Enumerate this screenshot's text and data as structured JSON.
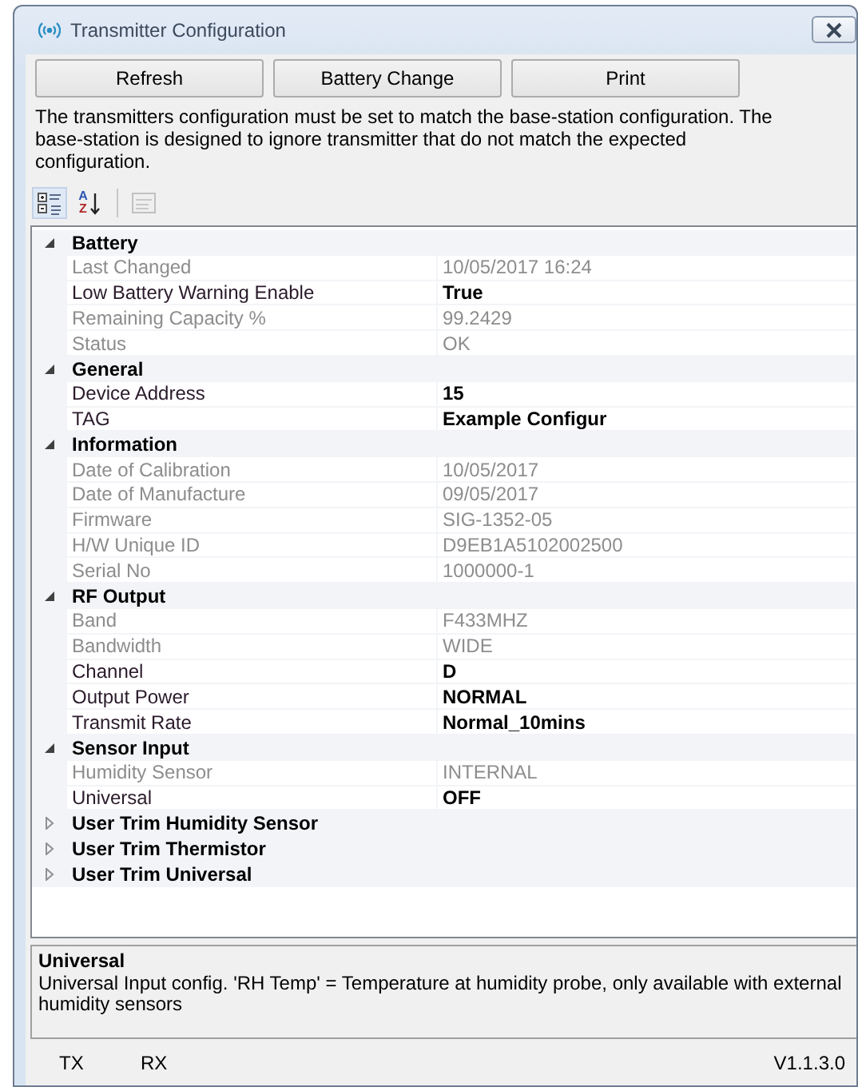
{
  "window": {
    "title": "Transmitter Configuration"
  },
  "buttons": [
    "Refresh",
    "Battery Change",
    "Print"
  ],
  "description": "The transmitters configuration must be set to match the base-station configuration. The base-station is designed to ignore transmitter that do not match the expected configuration.",
  "toolbar": [
    {
      "kind": "categorized",
      "selected": true,
      "disabled": false
    },
    {
      "kind": "alphabetical",
      "selected": false,
      "disabled": false,
      "letters": [
        "A",
        "Z"
      ]
    },
    {
      "kind": "property_pages",
      "selected": false,
      "disabled": true
    }
  ],
  "grid": {
    "categories": [
      {
        "name": "Battery",
        "expanded": true,
        "properties": [
          {
            "name": "Last Changed",
            "value": "10/05/2017 16:24",
            "readonly": true
          },
          {
            "name": "Low Battery Warning Enable",
            "value": "True",
            "readonly": false
          },
          {
            "name": "Remaining Capacity %",
            "value": "99.2429",
            "readonly": true
          },
          {
            "name": "Status",
            "value": "OK",
            "readonly": true
          }
        ]
      },
      {
        "name": "General",
        "expanded": true,
        "properties": [
          {
            "name": "Device Address",
            "value": "15",
            "readonly": false
          },
          {
            "name": "TAG",
            "value": "Example Configur",
            "readonly": false
          }
        ]
      },
      {
        "name": "Information",
        "expanded": true,
        "properties": [
          {
            "name": "Date of Calibration",
            "value": "10/05/2017",
            "readonly": true
          },
          {
            "name": "Date of Manufacture",
            "value": "09/05/2017",
            "readonly": true
          },
          {
            "name": "Firmware",
            "value": "SIG-1352-05",
            "readonly": true
          },
          {
            "name": "H/W Unique ID",
            "value": "D9EB1A5102002500",
            "readonly": true
          },
          {
            "name": "Serial No",
            "value": "1000000-1",
            "readonly": true
          }
        ]
      },
      {
        "name": "RF Output",
        "expanded": true,
        "properties": [
          {
            "name": "Band",
            "value": "F433MHZ",
            "readonly": true
          },
          {
            "name": "Bandwidth",
            "value": "WIDE",
            "readonly": true
          },
          {
            "name": "Channel",
            "value": "D",
            "readonly": false
          },
          {
            "name": "Output Power",
            "value": "NORMAL",
            "readonly": false
          },
          {
            "name": "Transmit Rate",
            "value": "Normal_10mins",
            "readonly": false
          }
        ]
      },
      {
        "name": "Sensor Input",
        "expanded": true,
        "properties": [
          {
            "name": "Humidity Sensor",
            "value": "INTERNAL",
            "readonly": true
          },
          {
            "name": "Universal",
            "value": "OFF",
            "readonly": false
          }
        ]
      },
      {
        "name": "User Trim Humidity Sensor",
        "expanded": false
      },
      {
        "name": "User Trim Thermistor",
        "expanded": false
      },
      {
        "name": "User Trim Universal",
        "expanded": false
      }
    ]
  },
  "help": {
    "title": "Universal",
    "text": "Universal Input config. 'RH Temp' = Temperature at humidity probe, only available with external humidity sensors"
  },
  "status_bar": {
    "items": [
      "TX",
      "RX"
    ],
    "version": "V1.1.3.0"
  }
}
